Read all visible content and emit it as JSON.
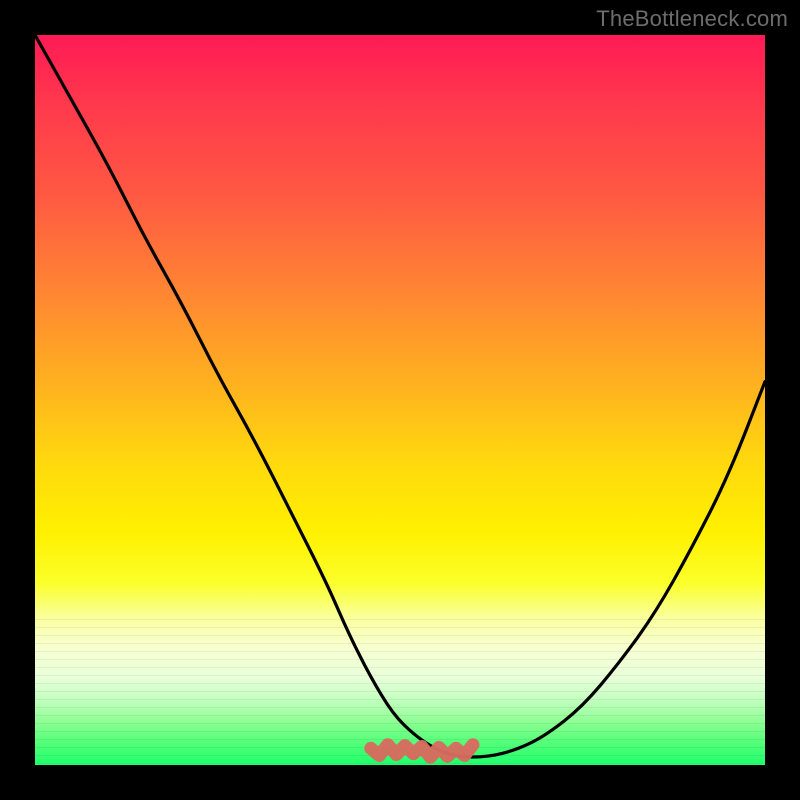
{
  "watermark": "TheBottleneck.com",
  "colors": {
    "frame": "#000000",
    "curve": "#000000",
    "highlight": "#d96a60",
    "gradient_top": "#ff1a55",
    "gradient_bottom": "#20ff6c"
  },
  "chart_data": {
    "type": "line",
    "title": "",
    "xlabel": "",
    "ylabel": "",
    "xlim": [
      0,
      100
    ],
    "ylim": [
      0,
      100
    ],
    "x": [
      0,
      5,
      10,
      15,
      20,
      25,
      30,
      35,
      40,
      43,
      46,
      49,
      52,
      55,
      58,
      62,
      66,
      70,
      75,
      80,
      85,
      90,
      95,
      100
    ],
    "values": [
      100,
      91,
      82,
      72,
      63,
      53,
      44,
      34,
      24,
      17,
      11,
      6,
      3,
      1,
      0,
      0,
      1,
      3,
      7,
      13,
      20,
      29,
      39,
      52
    ],
    "highlight_range_x": [
      46,
      60
    ],
    "highlight_description": "flat-bottom minimum region emphasized with salmon squiggle",
    "notes": "Bottleneck curve: V-shaped profile over rainbow heat gradient. Y≈100 indicates severe bottleneck (red), Y≈0 indicates optimal balance (green). Minimum (zero bottleneck) occurs roughly between x=55 and x=62."
  }
}
